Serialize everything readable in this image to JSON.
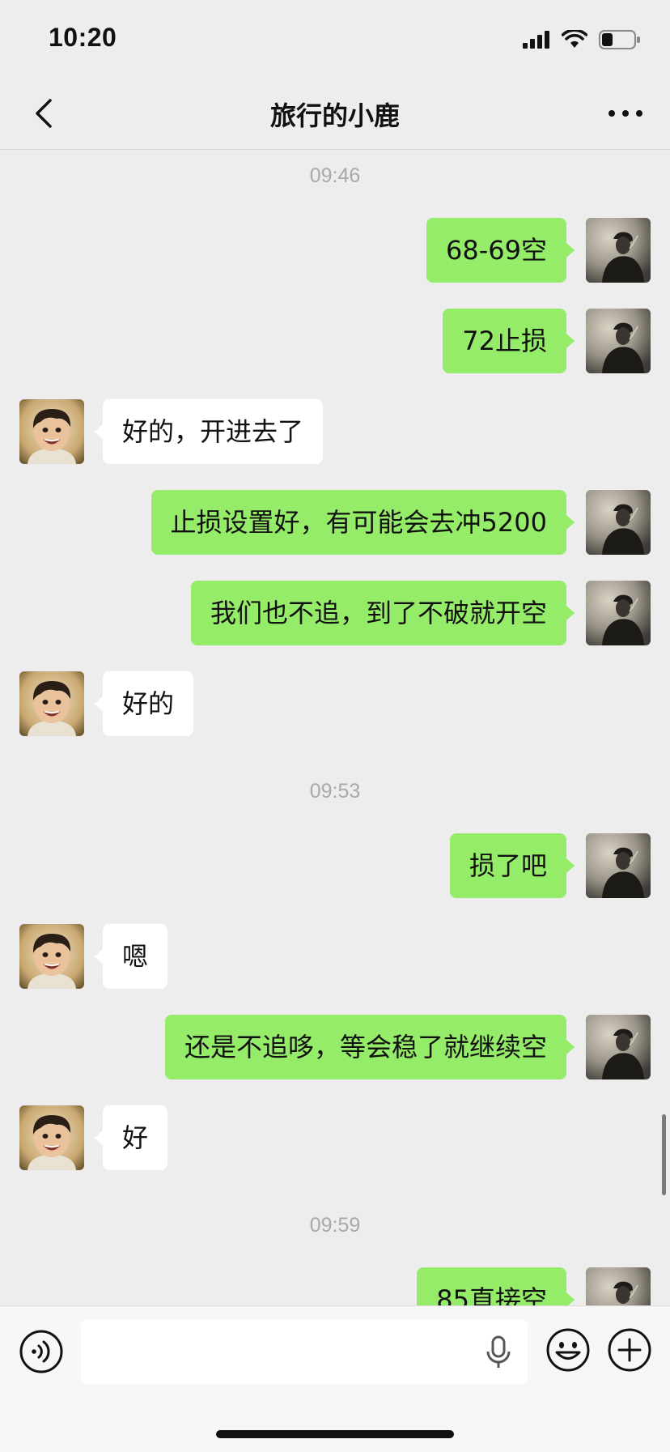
{
  "status_bar": {
    "time": "10:20",
    "icons": [
      "cellular-signal-icon",
      "wifi-icon",
      "battery-icon"
    ]
  },
  "header": {
    "back_icon": "chevron-left-icon",
    "title": "旅行的小鹿",
    "more_icon": "more-dots-icon"
  },
  "colors": {
    "background": "#ededed",
    "sent_bubble": "#95ec69",
    "received_bubble": "#ffffff",
    "timestamp": "#a9a9a9"
  },
  "messages": {
    "ts1": "09:46",
    "m1": "68-69空",
    "m2": "72止损",
    "m3": "好的，开进去了",
    "m4": "止损设置好，有可能会去冲5200",
    "m5": "我们也不追，到了不破就开空",
    "m6": "好的",
    "ts2": "09:53",
    "m7": "损了吧",
    "m8": "嗯",
    "m9": "还是不追哆，等会稳了就继续空",
    "m10": "好",
    "ts3": "09:59",
    "m11": "85直接空"
  },
  "input_bar": {
    "voice_icon": "voice-mode-icon",
    "text_value": "",
    "mic_icon": "microphone-icon",
    "emoji_icon": "emoji-icon",
    "plus_icon": "plus-circle-icon"
  }
}
